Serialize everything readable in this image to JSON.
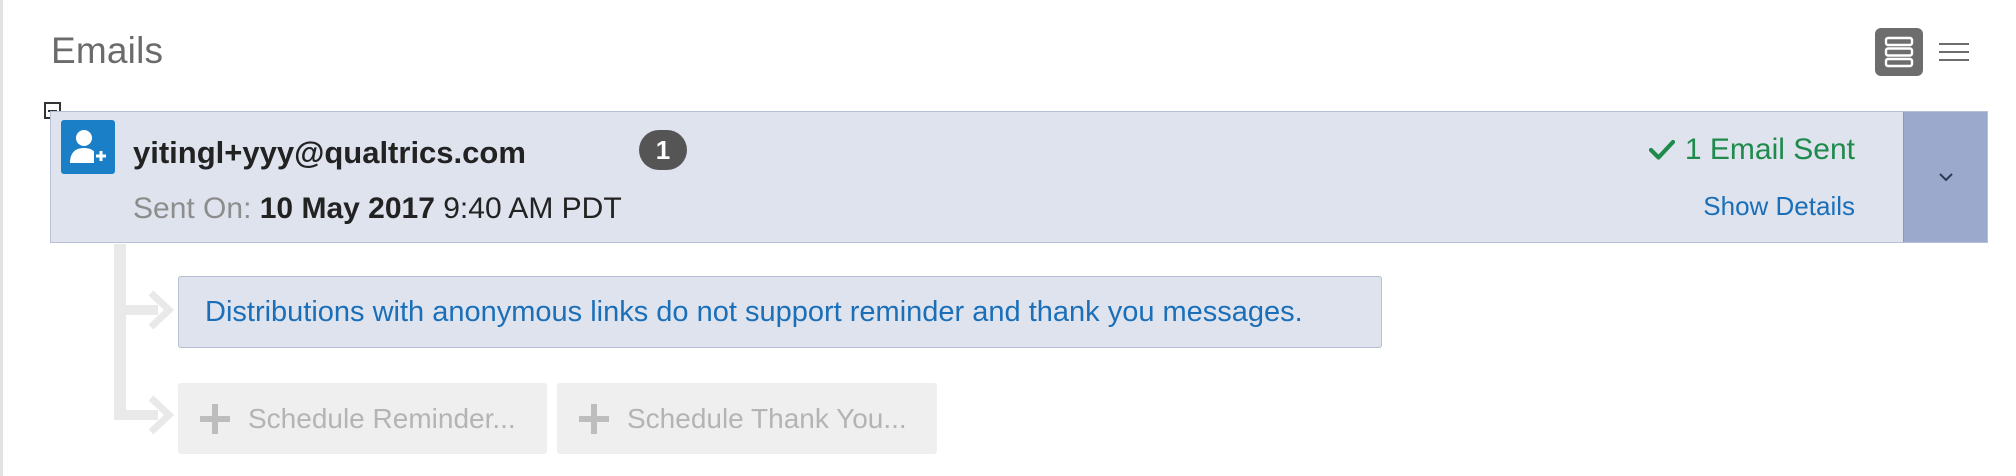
{
  "section": {
    "title": "Emails"
  },
  "view_toggle": {
    "card_icon": "card-view-icon",
    "list_icon": "list-view-icon"
  },
  "email": {
    "recipient": "yitingl+yyy@qualtrics.com",
    "count": "1",
    "sent_label": "Sent On:",
    "sent_date": "10 May 2017",
    "sent_time": "9:40 AM PDT",
    "status": "1 Email Sent",
    "status_icon": "checkmark-icon",
    "show_details": "Show Details",
    "avatar_icon": "contact-add-icon",
    "dropdown_icon": "chevron-down-icon"
  },
  "notice": {
    "text": "Distributions with anonymous links do not support reminder and thank you messages."
  },
  "actions": {
    "reminder": "Schedule Reminder...",
    "thank_you": "Schedule Thank You..."
  },
  "colors": {
    "card_bg": "#dfe3ee",
    "dropdown_bg": "#9ba9cc",
    "avatar_blue": "#1b7fc8",
    "link_blue": "#1a6fb8",
    "success_green": "#1e8a4c",
    "disabled_text": "#b4b4b4"
  }
}
